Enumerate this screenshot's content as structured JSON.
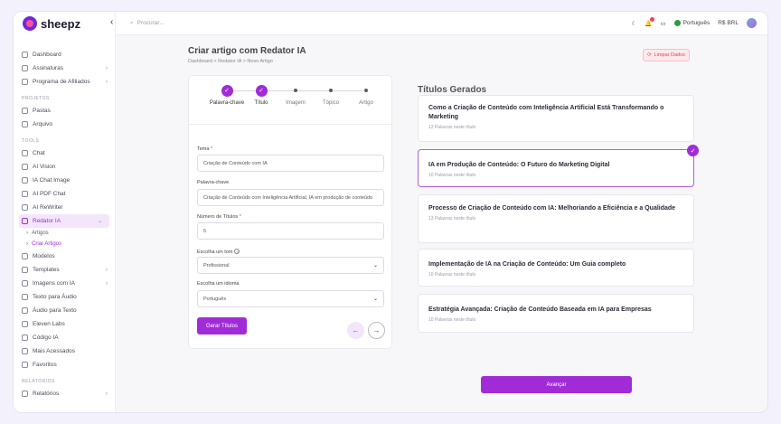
{
  "brand": {
    "name": "sheepz"
  },
  "search": {
    "placeholder": "Procurar..."
  },
  "header": {
    "language": "Português",
    "currency": "R$ BRL"
  },
  "sidebar": {
    "items_top": [
      {
        "label": "Dashboard",
        "icon": "dashboard-icon"
      },
      {
        "label": "Assinaturas",
        "icon": "subscription-icon",
        "chevron": true
      },
      {
        "label": "Programa de Afiliados",
        "icon": "affiliate-icon",
        "chevron": true
      }
    ],
    "section_projetos": "PROJETOS",
    "items_projetos": [
      {
        "label": "Pastas",
        "icon": "folder-icon"
      },
      {
        "label": "Arquivo",
        "icon": "archive-icon"
      }
    ],
    "section_tools": "TOOLS",
    "items_tools": [
      {
        "label": "Chat",
        "icon": "chat-icon"
      },
      {
        "label": "AI Vision",
        "icon": "vision-icon"
      },
      {
        "label": "IA Chat Image",
        "icon": "image-chat-icon"
      },
      {
        "label": "AI PDF Chat",
        "icon": "pdf-icon"
      },
      {
        "label": "AI ReWriter",
        "icon": "rewriter-icon"
      }
    ],
    "active_item": {
      "label": "Redator IA",
      "icon": "writer-icon"
    },
    "sub_items": [
      "Artigos",
      "Criar Artigos"
    ],
    "items_more": [
      {
        "label": "Modelos",
        "icon": "models-icon"
      },
      {
        "label": "Templates",
        "icon": "templates-icon",
        "chevron": true
      },
      {
        "label": "Imagens com IA",
        "icon": "images-icon",
        "chevron": true
      },
      {
        "label": "Texto para Áudio",
        "icon": "audio-icon"
      },
      {
        "label": "Áudio para Texto",
        "icon": "transcribe-icon"
      },
      {
        "label": "Eleven Labs",
        "icon": "eleven-icon"
      },
      {
        "label": "Código IA",
        "icon": "code-icon"
      },
      {
        "label": "Mais Acessados",
        "icon": "popular-icon"
      },
      {
        "label": "Favoritos",
        "icon": "star-icon"
      }
    ],
    "section_relatorios": "RELATÓRIOS",
    "items_relatorios": [
      {
        "label": "Relatórios",
        "icon": "reports-icon",
        "chevron": true
      }
    ]
  },
  "page": {
    "title": "Criar artigo com Redator IA",
    "breadcrumb": "Dashboard  >  Redator IA  >  Novo Artigo",
    "clear_label": "Limpar Dados"
  },
  "steps": [
    {
      "label": "Palavra-chave",
      "done": true
    },
    {
      "label": "Título",
      "done": true
    },
    {
      "label": "Imagem",
      "done": false
    },
    {
      "label": "Tópico",
      "done": false
    },
    {
      "label": "Artigo",
      "done": false
    }
  ],
  "form": {
    "tema_label": "Tema",
    "tema_value": "Criação de Conteúdo com IA",
    "palavra_label": "Palavra-chave",
    "palavra_value": "Criação de Conteúdo com Inteligência Artificial, IA em produção de conteúdo",
    "numero_label": "Número de Títulos",
    "numero_value": "5",
    "tom_label": "Escolha um tom",
    "tom_value": "Profissional",
    "idioma_label": "Escolha um idioma",
    "idioma_value": "Português",
    "generate_label": "Gerar Títulos"
  },
  "titles": {
    "heading": "Títulos Gerados",
    "items": [
      {
        "title": "Como a Criação de Conteúdo com Inteligência Artificial Está Transformando o Marketing",
        "meta": "12 Palavras neste título",
        "selected": false
      },
      {
        "title": "IA em Produção de Conteúdo: O Futuro do Marketing Digital",
        "meta": "10 Palavras neste título",
        "selected": true
      },
      {
        "title": "Processo de Criação de Conteúdo com IA: Melhoriando a Eficiência e a Qualidade",
        "meta": "13 Palavras neste título",
        "selected": false
      },
      {
        "title": "Implementação de IA na Criação de Conteúdo: Um Guia completo",
        "meta": "10 Palavras neste título",
        "selected": false
      },
      {
        "title": "Estratégia Avançada: Criação de Conteúdo Baseada em IA para Empresas",
        "meta": "10 Palavras neste título",
        "selected": false
      }
    ],
    "advance_label": "Avançar"
  },
  "colors": {
    "accent": "#a12bd6",
    "danger": "#e0445c"
  }
}
